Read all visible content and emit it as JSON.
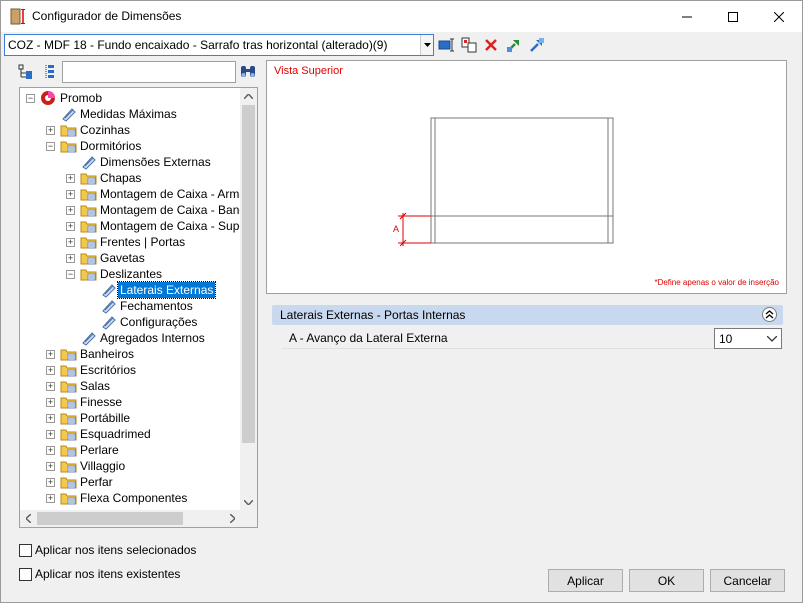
{
  "window": {
    "title": "Configurador de Dimensões"
  },
  "toolbar": {
    "combo_value": "COZ - MDF 18 - Fundo encaixado - Sarrafo tras horizontal (alterado)(9)"
  },
  "tree": {
    "search_value": "",
    "items": [
      {
        "label": "Promob"
      },
      {
        "label": "Medidas Máximas"
      },
      {
        "label": "Cozinhas"
      },
      {
        "label": "Dormitórios"
      },
      {
        "label": "Dimensões Externas"
      },
      {
        "label": "Chapas"
      },
      {
        "label": "Montagem de Caixa - Armário"
      },
      {
        "label": "Montagem de Caixa - Bancad"
      },
      {
        "label": "Montagem de Caixa - Superio"
      },
      {
        "label": "Frentes | Portas"
      },
      {
        "label": "Gavetas"
      },
      {
        "label": "Deslizantes"
      },
      {
        "label": "Laterais Externas"
      },
      {
        "label": "Fechamentos"
      },
      {
        "label": "Configurações"
      },
      {
        "label": "Agregados Internos"
      },
      {
        "label": "Banheiros"
      },
      {
        "label": "Escritórios"
      },
      {
        "label": "Salas"
      },
      {
        "label": "Finesse"
      },
      {
        "label": "Portábille"
      },
      {
        "label": "Esquadrimed"
      },
      {
        "label": "Perlare"
      },
      {
        "label": "Villaggio"
      },
      {
        "label": "Perfar"
      },
      {
        "label": "Flexa Componentes"
      }
    ]
  },
  "preview": {
    "title": "Vista Superior",
    "dimension_label": "A",
    "note": "*Define apenas o valor de inserção"
  },
  "properties": {
    "section_title": "Laterais Externas - Portas Internas",
    "rows": [
      {
        "label": "A - Avanço da Lateral Externa",
        "value": "10"
      }
    ]
  },
  "options": {
    "apply_selected": "Aplicar nos itens selecionados",
    "apply_existing": "Aplicar nos itens existentes"
  },
  "buttons": {
    "apply": "Aplicar",
    "ok": "OK",
    "cancel": "Cancelar"
  },
  "colors": {
    "accent": "#0078d7",
    "red_text": "#e00000",
    "section_header": "#c8d8ee"
  }
}
